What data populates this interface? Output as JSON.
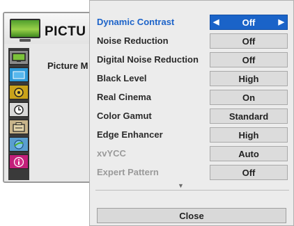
{
  "background_menu": {
    "title": "PICTU",
    "sub_label": "Picture M",
    "category_icons": [
      "picture-icon",
      "screen-icon",
      "audio-icon",
      "time-icon",
      "option-icon",
      "network-icon",
      "info-icon"
    ],
    "selected_category": "picture-icon"
  },
  "submenu": {
    "items": [
      {
        "label": "Dynamic Contrast",
        "value": "Off",
        "active": true,
        "disabled": false
      },
      {
        "label": "Noise Reduction",
        "value": "Off",
        "active": false,
        "disabled": false
      },
      {
        "label": "Digital Noise Reduction",
        "value": "Off",
        "active": false,
        "disabled": false
      },
      {
        "label": "Black Level",
        "value": "High",
        "active": false,
        "disabled": false
      },
      {
        "label": "Real Cinema",
        "value": "On",
        "active": false,
        "disabled": false
      },
      {
        "label": "Color Gamut",
        "value": "Standard",
        "active": false,
        "disabled": false
      },
      {
        "label": "Edge Enhancer",
        "value": "High",
        "active": false,
        "disabled": false
      },
      {
        "label": "xvYCC",
        "value": "Auto",
        "active": false,
        "disabled": true
      },
      {
        "label": "Expert Pattern",
        "value": "Off",
        "active": false,
        "disabled": true
      }
    ],
    "left_arrow": "◀",
    "right_arrow": "▶",
    "scroll_down_glyph": "▼",
    "close_label": "Close"
  },
  "colors": {
    "accent": "#1a63c8",
    "active_label": "#1c63c9",
    "disabled_label": "#9a9a9a"
  }
}
